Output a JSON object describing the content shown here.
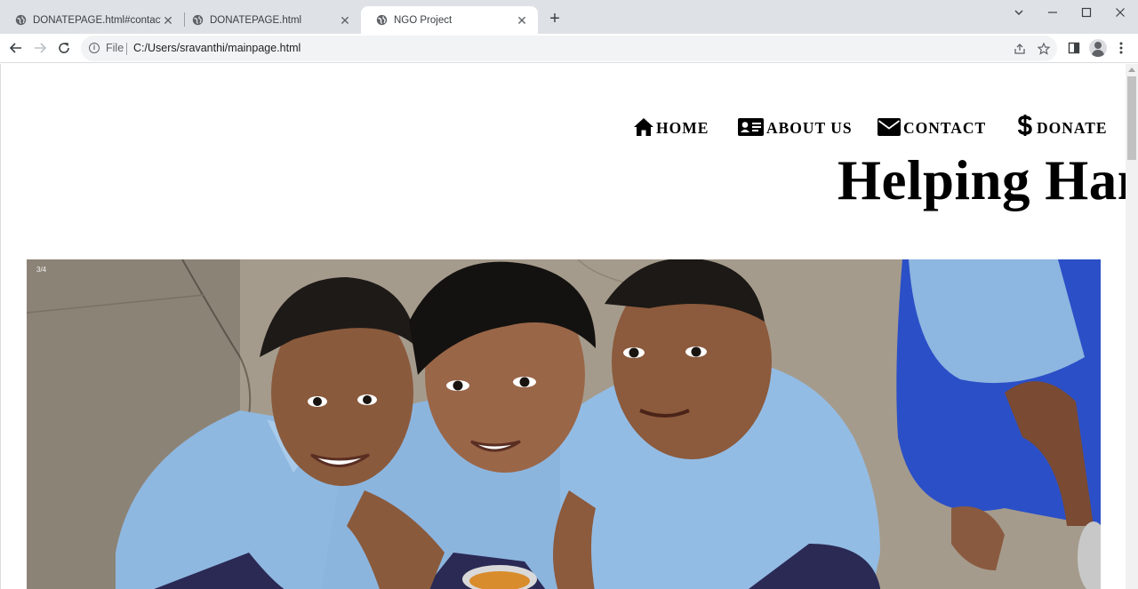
{
  "browser": {
    "tabs": [
      {
        "title": "DONATEPAGE.html#contact",
        "active": false
      },
      {
        "title": "DONATEPAGE.html",
        "active": false
      },
      {
        "title": "NGO Project",
        "active": true
      }
    ],
    "address": {
      "scheme_label": "File",
      "url": "C:/Users/sravanthi/mainpage.html"
    }
  },
  "page": {
    "nav": {
      "home": "HOME",
      "about": "ABOUT US",
      "contact": "CONTACT",
      "donate": "DONATE"
    },
    "hero_title": "Helping Hands",
    "slideshow": {
      "counter": "3/4"
    }
  },
  "colors": {
    "tabstrip_bg": "#dee1e6",
    "omnibox_bg": "#f1f3f4",
    "shirt_blue": "#8fb8e0",
    "ground": "#a59b8c"
  }
}
